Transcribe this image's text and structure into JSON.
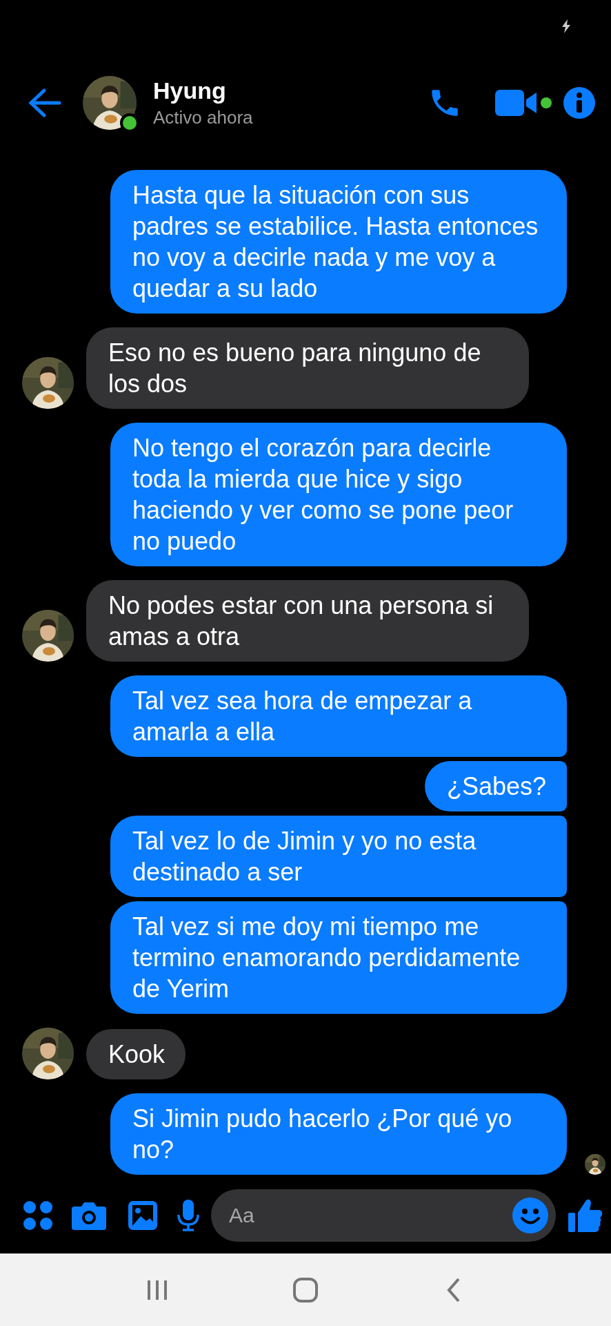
{
  "header": {
    "name": "Hyung",
    "status": "Activo ahora",
    "online": true
  },
  "messages": [
    {
      "kind": "sent",
      "text": "Hasta que la situación con sus padres se estabilice. Hasta entonces no voy a decirle nada y me voy a quedar a su lado"
    },
    {
      "kind": "received",
      "text": "Eso no es bueno para ninguno de los dos"
    },
    {
      "kind": "sent",
      "text": "No tengo el corazón para decirle toda la mierda que hice y sigo haciendo y ver como se pone peor no puedo"
    },
    {
      "kind": "received",
      "text": "No podes estar con una persona si amas a otra"
    },
    {
      "kind": "sent",
      "text": "Tal vez sea hora de empezar a amarla a ella"
    },
    {
      "kind": "sent",
      "text": "¿Sabes?"
    },
    {
      "kind": "sent",
      "text": "Tal vez lo de Jimin y yo no esta destinado a ser"
    },
    {
      "kind": "sent",
      "text": "Tal vez si me doy mi tiempo me termino enamorando perdidamente de Yerim"
    },
    {
      "kind": "received",
      "text": "Kook"
    },
    {
      "kind": "sent",
      "text": "Si Jimin pudo hacerlo ¿Por qué yo no?"
    }
  ],
  "composer": {
    "placeholder": "Aa"
  }
}
